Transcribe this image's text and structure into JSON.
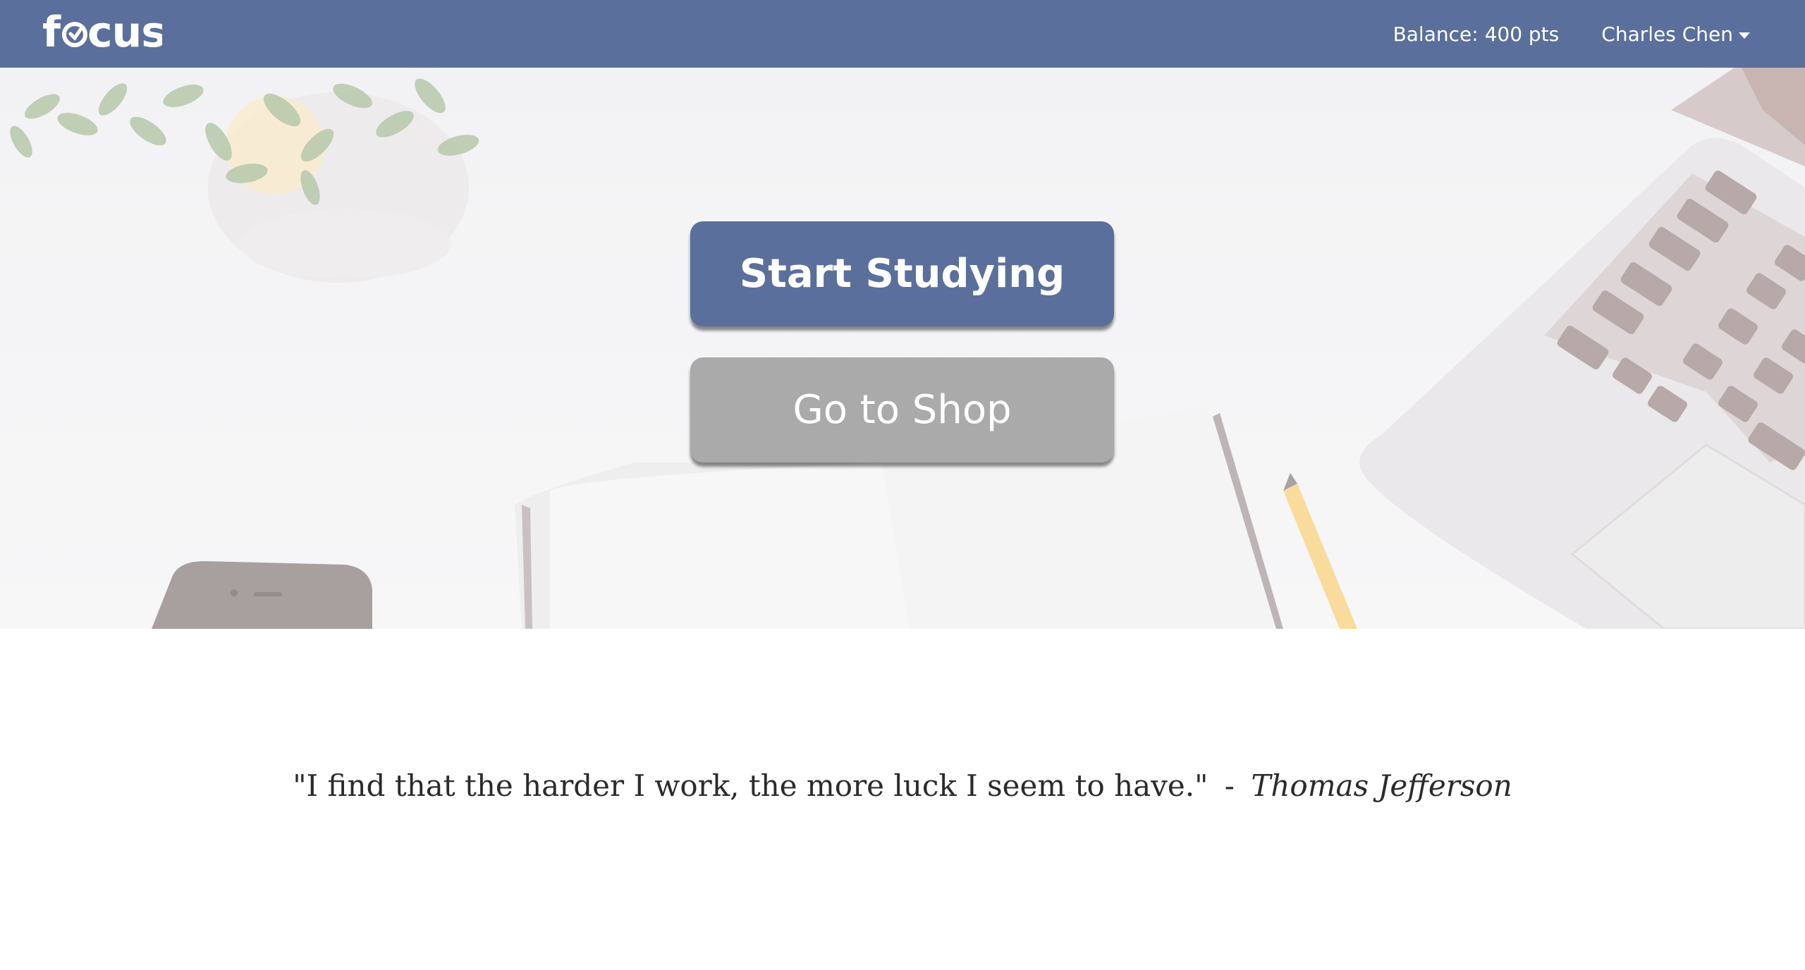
{
  "navbar": {
    "brand": "focus",
    "balance": "Balance: 400 pts",
    "user_name": "Charles Chen"
  },
  "hero": {
    "start_label": "Start Studying",
    "shop_label": "Go to Shop"
  },
  "quote": {
    "text": "\"I find that the harder I work, the more luck I seem to have.\"",
    "separator": "-",
    "author": "Thomas Jefferson"
  },
  "colors": {
    "brand": "#5a6f9b",
    "secondary_button": "#aaaaaa",
    "text": "#2b2b2b"
  },
  "icons": [
    "focus-logo-clock-icon",
    "caret-down-icon"
  ]
}
